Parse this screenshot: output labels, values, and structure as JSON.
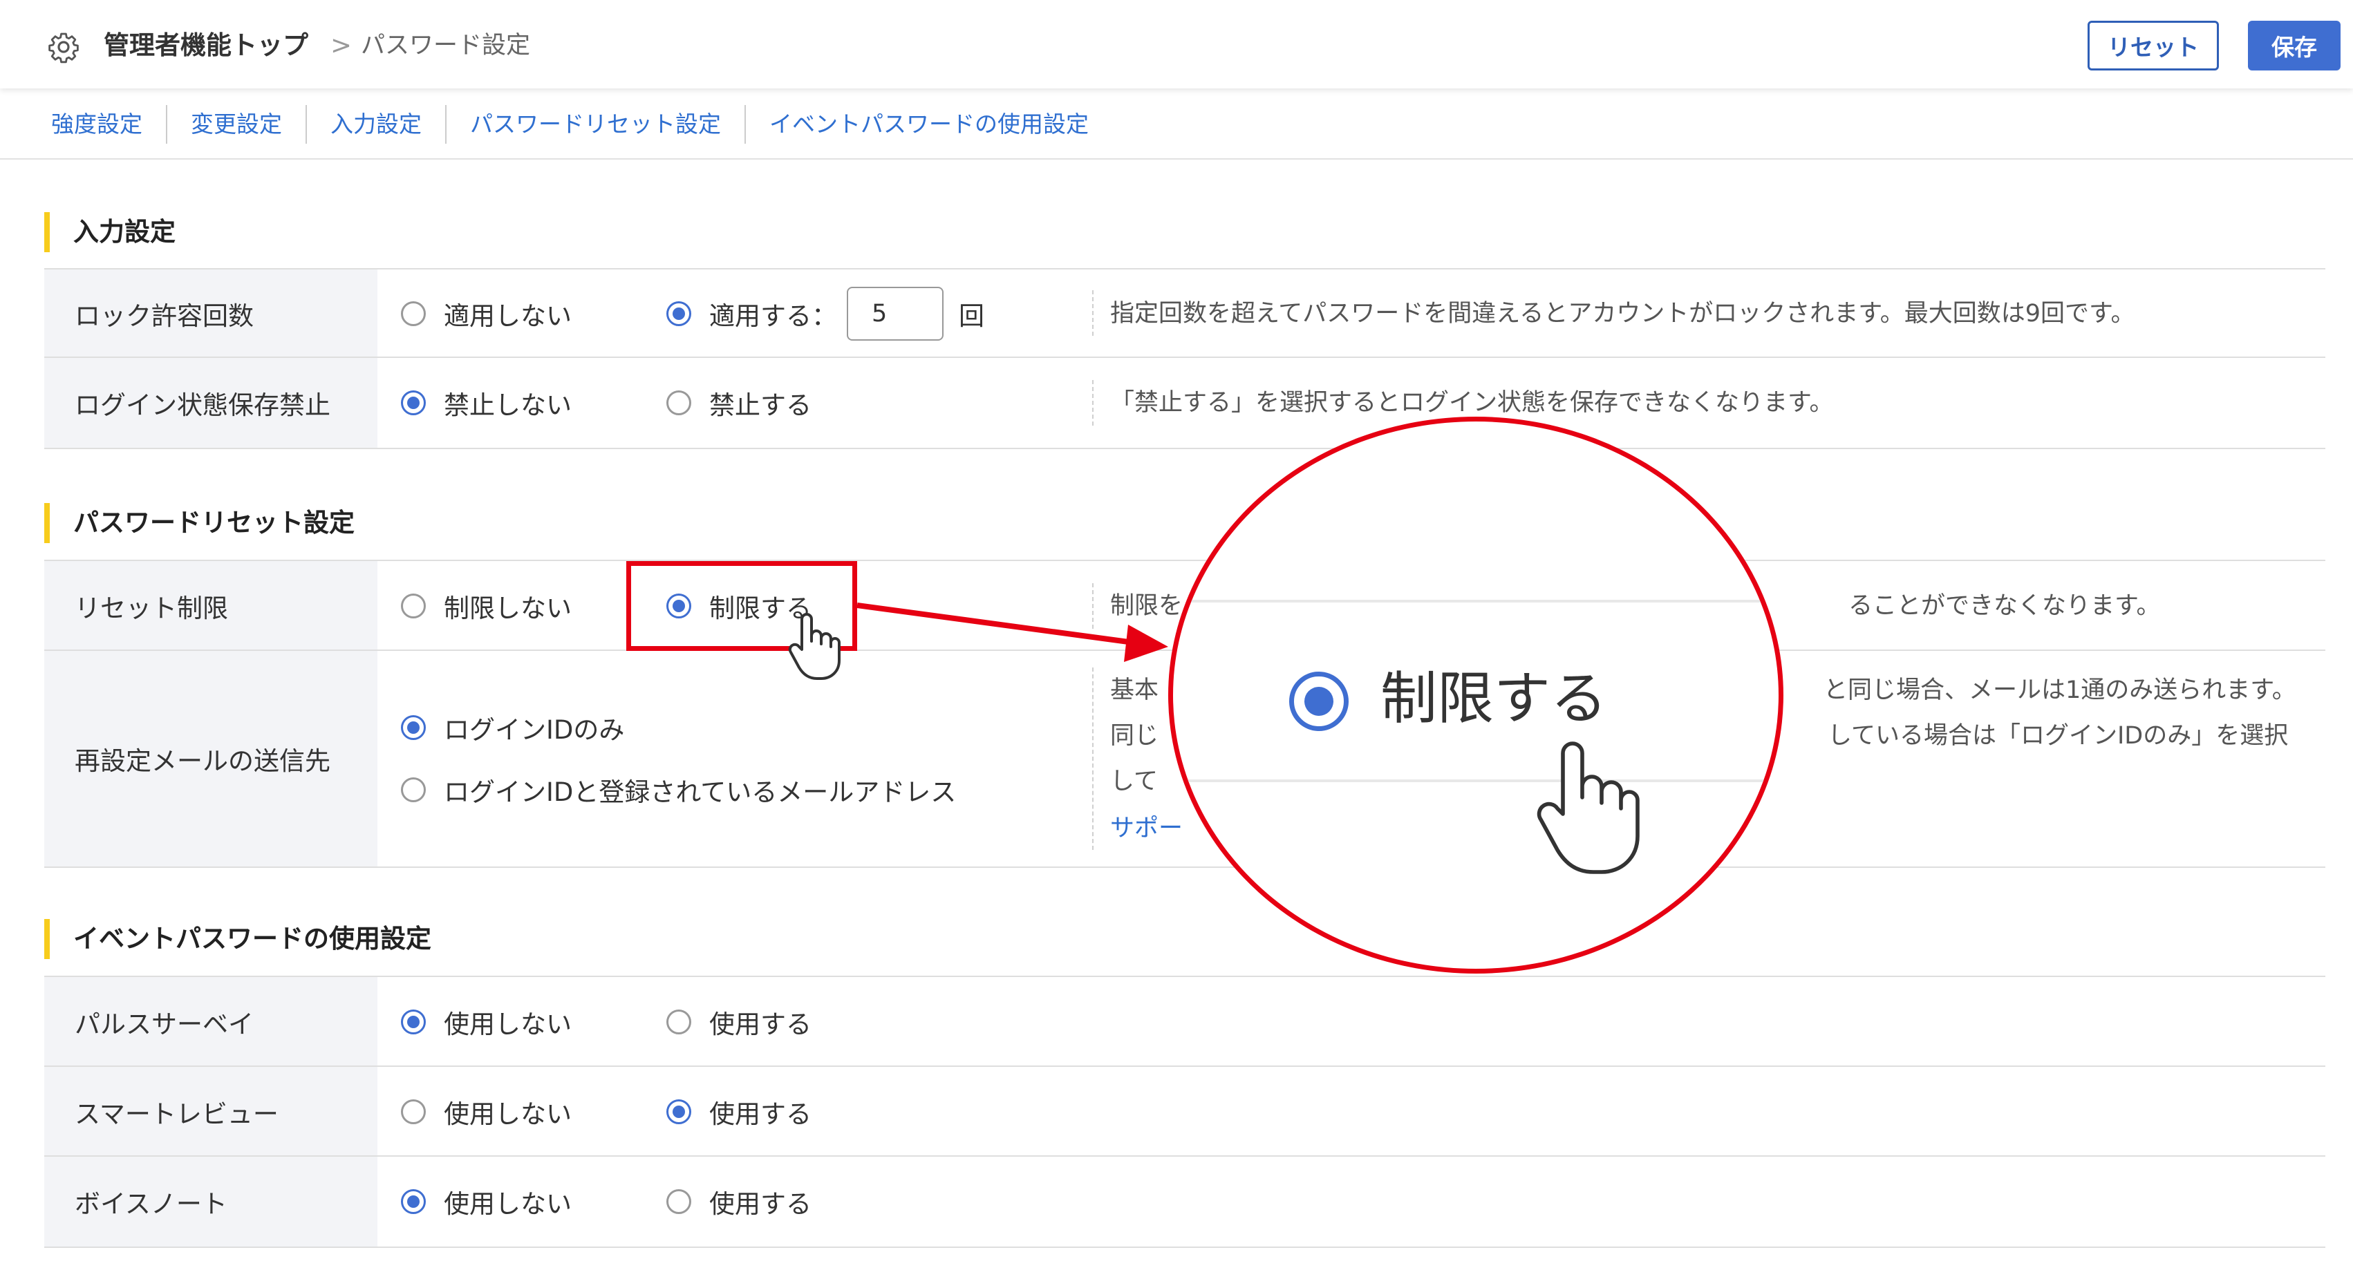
{
  "header": {
    "breadcrumb_home": "管理者機能トップ",
    "breadcrumb_separator": ">",
    "breadcrumb_current": "パスワード設定",
    "reset_label": "リセット",
    "save_label": "保存"
  },
  "tabs": [
    "強度設定",
    "変更設定",
    "入力設定",
    "パスワードリセット設定",
    "イベントパスワードの使用設定"
  ],
  "sections": {
    "input": {
      "title": "入力設定",
      "lock": {
        "label": "ロック許容回数",
        "opt_off": "適用しない",
        "opt_on": "適用する：",
        "value": "5",
        "unit": "回",
        "selected": "opt_on",
        "desc": "指定回数を超えてパスワードを間違えるとアカウントがロックされます。最大回数は9回です。"
      },
      "login_keep": {
        "label": "ログイン状態保存禁止",
        "opt_off": "禁止しない",
        "opt_on": "禁止する",
        "selected": "opt_off",
        "desc": "「禁止する」を選択するとログイン状態を保存できなくなります。"
      }
    },
    "reset": {
      "title": "パスワードリセット設定",
      "limit": {
        "label": "リセット制限",
        "opt_off": "制限しない",
        "opt_on": "制限する",
        "selected": "opt_on",
        "desc_left": "制限を",
        "desc_right": "ることができなくなります。"
      },
      "mail": {
        "label": "再設定メールの送信先",
        "opt_1": "ログインIDのみ",
        "opt_2": "ログインIDと登録されているメールアドレス",
        "selected": "opt_1",
        "desc_l1": "基本",
        "desc_l2": "同じ",
        "desc_l3": "して",
        "desc_r1": "と同じ場合、メールは1通のみ送られます。",
        "desc_r2": "している場合は「ログインIDのみ」を選択",
        "support_link": "サポー"
      }
    },
    "event": {
      "title": "イベントパスワードの使用設定",
      "rows": [
        {
          "label": "パルスサーベイ",
          "opt_off": "使用しない",
          "opt_on": "使用する",
          "selected": "opt_off"
        },
        {
          "label": "スマートレビュー",
          "opt_off": "使用しない",
          "opt_on": "使用する",
          "selected": "opt_on"
        },
        {
          "label": "ボイスノート",
          "opt_off": "使用しない",
          "opt_on": "使用する",
          "selected": "opt_off"
        }
      ]
    }
  },
  "zoom": {
    "label": "制限する"
  },
  "colors": {
    "accent": "#3f6ed1",
    "link": "#2f6fd0",
    "highlight": "#e60012",
    "section_marker": "#f7cc1c"
  }
}
